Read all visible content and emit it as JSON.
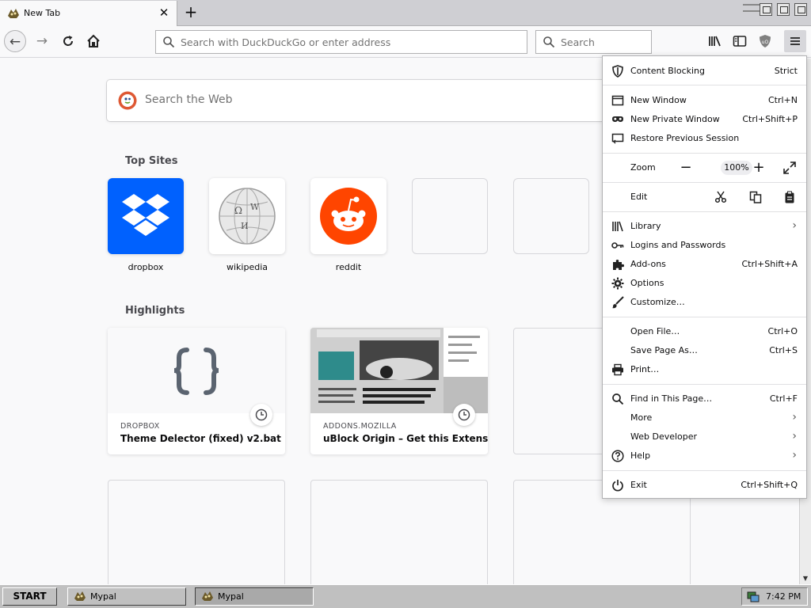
{
  "tab": {
    "title": "New Tab"
  },
  "urlbar": {
    "placeholder": "Search with DuckDuckGo or enter address"
  },
  "searchbar": {
    "placeholder": "Search"
  },
  "newtab": {
    "web_search_placeholder": "Search the Web",
    "top_sites_title": "Top Sites",
    "top_sites": [
      {
        "label": "dropbox"
      },
      {
        "label": "wikipedia"
      },
      {
        "label": "reddit"
      }
    ],
    "highlights_title": "Highlights",
    "highlights": [
      {
        "source": "DROPBOX",
        "title": "Theme Delector (fixed) v2.bat"
      },
      {
        "source": "ADDONS.MOZILLA",
        "title": "uBlock Origin – Get this Extensio…"
      }
    ]
  },
  "menu": {
    "content_blocking": {
      "label": "Content Blocking",
      "value": "Strict"
    },
    "new_window": {
      "label": "New Window",
      "shortcut": "Ctrl+N"
    },
    "private_window": {
      "label": "New Private Window",
      "shortcut": "Ctrl+Shift+P"
    },
    "restore_session": {
      "label": "Restore Previous Session"
    },
    "zoom": {
      "label": "Zoom",
      "value": "100%"
    },
    "edit": {
      "label": "Edit"
    },
    "library": {
      "label": "Library"
    },
    "logins": {
      "label": "Logins and Passwords"
    },
    "addons": {
      "label": "Add-ons",
      "shortcut": "Ctrl+Shift+A"
    },
    "options": {
      "label": "Options"
    },
    "customize": {
      "label": "Customize…"
    },
    "open_file": {
      "label": "Open File…",
      "shortcut": "Ctrl+O"
    },
    "save_page": {
      "label": "Save Page As…",
      "shortcut": "Ctrl+S"
    },
    "print": {
      "label": "Print…"
    },
    "find": {
      "label": "Find in This Page…",
      "shortcut": "Ctrl+F"
    },
    "more": {
      "label": "More"
    },
    "web_developer": {
      "label": "Web Developer"
    },
    "help": {
      "label": "Help"
    },
    "exit": {
      "label": "Exit",
      "shortcut": "Ctrl+Shift+Q"
    }
  },
  "taskbar": {
    "start": "START",
    "buttons": [
      {
        "label": "Mypal"
      },
      {
        "label": "Mypal"
      }
    ],
    "clock": "7:42 PM"
  },
  "colors": {
    "dropbox": "#0061fe",
    "reddit": "#ff4500",
    "menu_active": "#d7d7db"
  }
}
